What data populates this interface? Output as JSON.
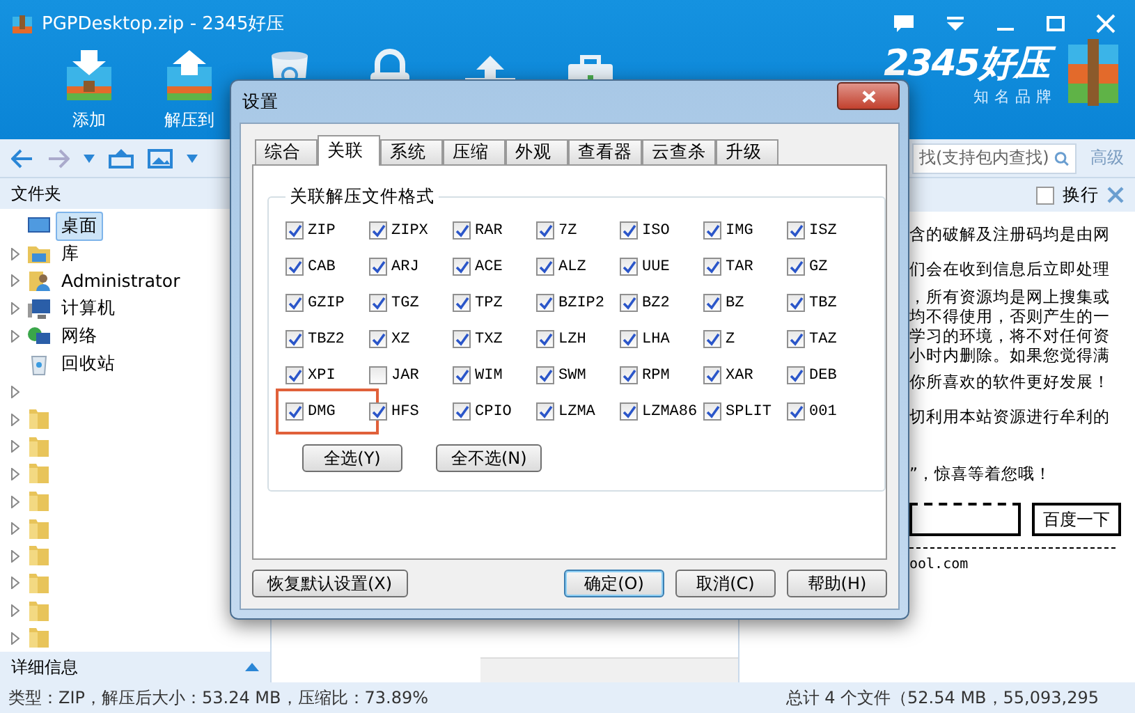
{
  "window": {
    "title": "PGPDesktop.zip - 2345好压"
  },
  "toolbar": [
    {
      "kind": "add",
      "label": "添加"
    },
    {
      "kind": "extract",
      "label": "解压到"
    },
    {
      "kind": "delete"
    },
    {
      "kind": "lock"
    },
    {
      "kind": "share"
    },
    {
      "kind": "toolbox"
    }
  ],
  "logo": {
    "name": "2345好压",
    "slogan": "知名品牌"
  },
  "search": {
    "placeholder": "找(支持包内查找)",
    "advanced": "高级"
  },
  "folders": {
    "title": "文件夹",
    "items": [
      {
        "kind": "desktop",
        "label": "桌面",
        "selected": true,
        "expandable": false
      },
      {
        "kind": "library",
        "label": "库",
        "selected": false,
        "expandable": true
      },
      {
        "kind": "user",
        "label": "Administrator",
        "selected": false,
        "expandable": true
      },
      {
        "kind": "computer",
        "label": "计算机",
        "selected": false,
        "expandable": true
      },
      {
        "kind": "network",
        "label": "网络",
        "selected": false,
        "expandable": true
      },
      {
        "kind": "recycle",
        "label": "回收站",
        "selected": false,
        "expandable": false
      },
      {
        "kind": "blank",
        "selected": false,
        "expandable": true
      },
      {
        "kind": "folder",
        "selected": false,
        "expandable": true
      },
      {
        "kind": "folder",
        "selected": false,
        "expandable": true
      },
      {
        "kind": "folder",
        "selected": false,
        "expandable": true
      },
      {
        "kind": "folder",
        "selected": false,
        "expandable": true
      },
      {
        "kind": "folder",
        "selected": false,
        "expandable": true
      },
      {
        "kind": "folder",
        "selected": false,
        "expandable": true
      },
      {
        "kind": "folder",
        "selected": false,
        "expandable": true
      },
      {
        "kind": "folder",
        "selected": false,
        "expandable": true
      },
      {
        "kind": "folder",
        "selected": false,
        "expandable": true
      }
    ]
  },
  "details": {
    "title": "详细信息"
  },
  "preview": {
    "wrap_label": "换行",
    "wrap_checked": false,
    "lines": [
      {
        "kind": "text",
        "text": "含的破解及注册码均是由网"
      },
      {
        "kind": "text",
        "text": "们会在收到信息后立即处理"
      },
      {
        "kind": "tight",
        "text": "，所有资源均是网上搜集或"
      },
      {
        "kind": "tight",
        "text": "均不得使用，否则产生的一"
      },
      {
        "kind": "tight",
        "text": "学习的环境，将不对任何资"
      },
      {
        "kind": "tight",
        "text": "小时内删除。如果您觉得满"
      },
      {
        "kind": "text",
        "text": "你所喜欢的软件更好发展！"
      },
      {
        "kind": "text",
        "text": "切利用本站资源进行牟利的"
      },
      {
        "kind": "gap"
      },
      {
        "kind": "text",
        "text": "”，惊喜等着您哦！"
      }
    ],
    "search_button": "百度一下",
    "footer": "ool.com"
  },
  "status_bar": {
    "left": "类型：ZIP，解压后大小：53.24 MB，压缩比：73.89%",
    "right": "总计 4 个文件（52.54 MB，55,093,295"
  },
  "dialog": {
    "title": "设置",
    "tabs": [
      {
        "label": "综合",
        "selected": false
      },
      {
        "label": "关联",
        "selected": true
      },
      {
        "label": "系统",
        "selected": false
      },
      {
        "label": "压缩",
        "selected": false
      },
      {
        "label": "外观",
        "selected": false
      },
      {
        "label": "查看器",
        "selected": false
      },
      {
        "label": "云查杀",
        "selected": false
      },
      {
        "label": "升级",
        "selected": false
      }
    ],
    "group_title": "关联解压文件格式",
    "formats": [
      {
        "label": "ZIP",
        "checked": true,
        "highlighted": false
      },
      {
        "label": "ZIPX",
        "checked": true,
        "highlighted": false
      },
      {
        "label": "RAR",
        "checked": true,
        "highlighted": false
      },
      {
        "label": "7Z",
        "checked": true,
        "highlighted": false
      },
      {
        "label": "ISO",
        "checked": true,
        "highlighted": false
      },
      {
        "label": "IMG",
        "checked": true,
        "highlighted": false
      },
      {
        "label": "ISZ",
        "checked": true,
        "highlighted": false
      },
      {
        "label": "CAB",
        "checked": true,
        "highlighted": false
      },
      {
        "label": "ARJ",
        "checked": true,
        "highlighted": false
      },
      {
        "label": "ACE",
        "checked": true,
        "highlighted": false
      },
      {
        "label": "ALZ",
        "checked": true,
        "highlighted": false
      },
      {
        "label": "UUE",
        "checked": true,
        "highlighted": false
      },
      {
        "label": "TAR",
        "checked": true,
        "highlighted": false
      },
      {
        "label": "GZ",
        "checked": true,
        "highlighted": false
      },
      {
        "label": "GZIP",
        "checked": true,
        "highlighted": false
      },
      {
        "label": "TGZ",
        "checked": true,
        "highlighted": false
      },
      {
        "label": "TPZ",
        "checked": true,
        "highlighted": false
      },
      {
        "label": "BZIP2",
        "checked": true,
        "highlighted": false
      },
      {
        "label": "BZ2",
        "checked": true,
        "highlighted": false
      },
      {
        "label": "BZ",
        "checked": true,
        "highlighted": false
      },
      {
        "label": "TBZ",
        "checked": true,
        "highlighted": false
      },
      {
        "label": "TBZ2",
        "checked": true,
        "highlighted": false
      },
      {
        "label": "XZ",
        "checked": true,
        "highlighted": false
      },
      {
        "label": "TXZ",
        "checked": true,
        "highlighted": false
      },
      {
        "label": "LZH",
        "checked": true,
        "highlighted": false
      },
      {
        "label": "LHA",
        "checked": true,
        "highlighted": false
      },
      {
        "label": "Z",
        "checked": true,
        "highlighted": false
      },
      {
        "label": "TAZ",
        "checked": true,
        "highlighted": false
      },
      {
        "label": "XPI",
        "checked": true,
        "highlighted": false
      },
      {
        "label": "JAR",
        "checked": false,
        "highlighted": false
      },
      {
        "label": "WIM",
        "checked": true,
        "highlighted": false
      },
      {
        "label": "SWM",
        "checked": true,
        "highlighted": false
      },
      {
        "label": "RPM",
        "checked": true,
        "highlighted": false
      },
      {
        "label": "XAR",
        "checked": true,
        "highlighted": false
      },
      {
        "label": "DEB",
        "checked": true,
        "highlighted": false
      },
      {
        "label": "DMG",
        "checked": true,
        "highlighted": true
      },
      {
        "label": "HFS",
        "checked": true,
        "highlighted": false
      },
      {
        "label": "CPIO",
        "checked": true,
        "highlighted": false
      },
      {
        "label": "LZMA",
        "checked": true,
        "highlighted": false
      },
      {
        "label": "LZMA86",
        "checked": true,
        "highlighted": false
      },
      {
        "label": "SPLIT",
        "checked": true,
        "highlighted": false
      },
      {
        "label": "001",
        "checked": true,
        "highlighted": false
      }
    ],
    "select_all": "全选(Y)",
    "select_none": "全不选(N)",
    "restore": "恢复默认设置(X)",
    "ok": "确定(O)",
    "cancel": "取消(C)",
    "help": "帮助(H)"
  }
}
